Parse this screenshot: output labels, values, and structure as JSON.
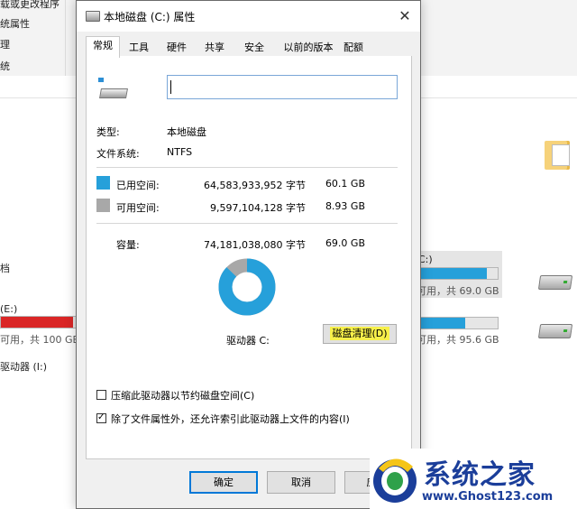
{
  "background": {
    "menu_items": [
      "载或更改程序",
      "统属性",
      "理",
      "统"
    ],
    "folders": {
      "documents": "档"
    },
    "drives": [
      {
        "name": "C:)",
        "sub": "可用，共 69.0 GB",
        "fill_ratio": 0.87,
        "color": "#26a0da"
      },
      {
        "name": "(E:)",
        "sub": "可用，共 100 GB",
        "fill_ratio": 0.95,
        "color": "#da2626"
      },
      {
        "name": "",
        "sub": "可用，共 95.6 GB",
        "fill_ratio": 0.6,
        "color": "#26a0da"
      },
      {
        "name": "驱动器 (I:)",
        "sub": "",
        "fill_ratio": null,
        "color": ""
      }
    ]
  },
  "dialog": {
    "title": "本地磁盘 (C:) 属性",
    "close_glyph": "✕",
    "tabs": [
      "常规",
      "工具",
      "硬件",
      "共享",
      "安全",
      "以前的版本",
      "配额"
    ],
    "active_tab": 0,
    "name_field_value": "",
    "type_label": "类型:",
    "type_value": "本地磁盘",
    "fs_label": "文件系统:",
    "fs_value": "NTFS",
    "used": {
      "label": "已用空间:",
      "bytes": "64,583,933,952 字节",
      "size": "60.1 GB",
      "color": "#26a0da"
    },
    "free": {
      "label": "可用空间:",
      "bytes": "9,597,104,128 字节",
      "size": "8.93 GB",
      "color": "#a8a8a8"
    },
    "capacity": {
      "label": "容量:",
      "bytes": "74,181,038,080 字节",
      "size": "69.0 GB"
    },
    "used_fraction": 0.8706,
    "drive_label": "驱动器 C:",
    "cleanup_button": "磁盘清理(D)",
    "compress_label": "压缩此驱动器以节约磁盘空间(C)",
    "compress_checked": false,
    "index_label": "除了文件属性外，还允许索引此驱动器上文件的内容(I)",
    "index_checked": true,
    "ok_button": "确定",
    "cancel_button": "取消",
    "apply_button": "应"
  },
  "watermark": {
    "title": "系统之家",
    "url": "www.Ghost123.com"
  }
}
